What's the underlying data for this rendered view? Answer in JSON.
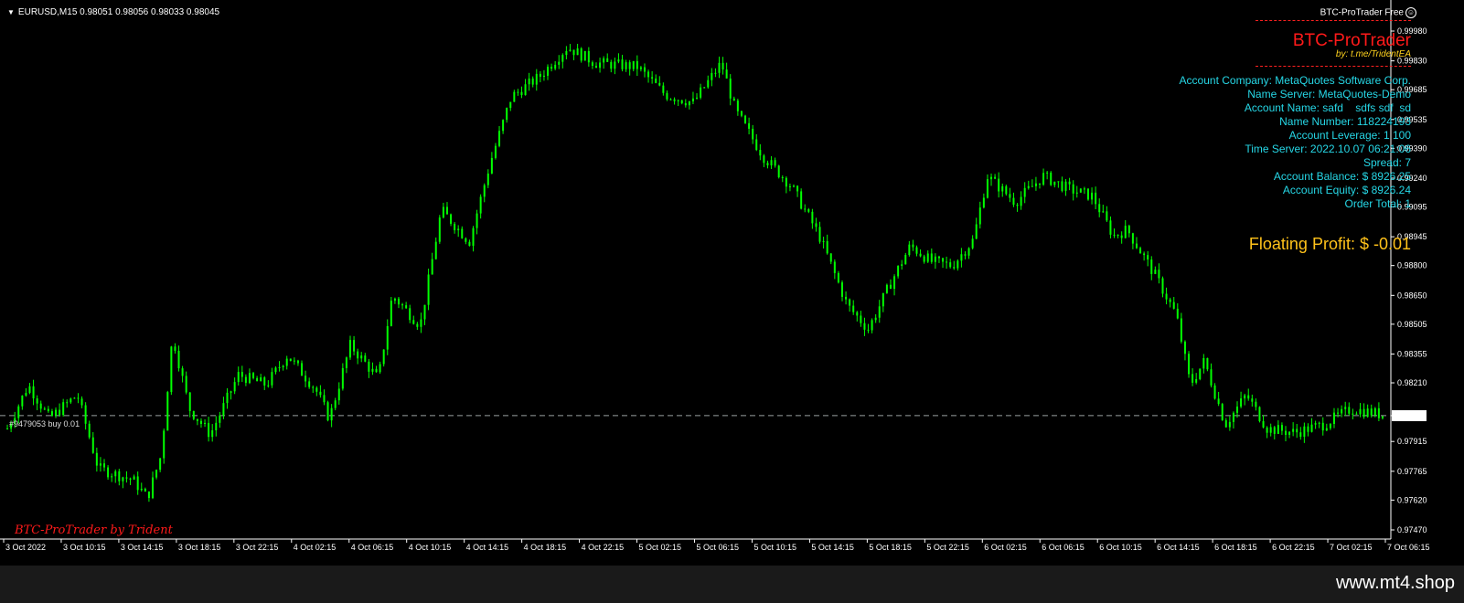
{
  "window": {
    "symbol_line": "EURUSD,M15  0.98051 0.98056 0.98033 0.98045",
    "ea_status": "BTC-ProTrader Free"
  },
  "brand": {
    "title": "BTC-ProTrader",
    "subtitle": "by: t.me/TridentEA",
    "accent_color": "#ff1a1a",
    "sub_color": "#ffd21e"
  },
  "account_info": [
    "Account Company: MetaQuotes Software Corp.",
    "Name Server: MetaQuotes-Demo",
    "Account Name: safd    sdfs sdf  sd",
    "Name Number: 118224193",
    "Account Leverage: 1 100",
    "Time Server: 2022.10.07 06:21:06",
    "Spread: 7",
    "Account Balance: $ 8926.25",
    "Account Equity: $ 8926.24",
    "Order Total: 1"
  ],
  "floating_profit": "Floating Profit: $ -0.01",
  "watermark": "BTC-ProTrader by Trident",
  "order_label": "#9479053 buy 0.01",
  "footer": "www.mt4.shop",
  "colors": {
    "candle": "#00ff00",
    "info_text": "#26d7e6",
    "floating_profit": "#ffc21a",
    "background": "#000000"
  },
  "chart_data": {
    "type": "candlestick",
    "symbol": "EURUSD",
    "timeframe": "M15",
    "current_price": "0.98045",
    "price_ticks": [
      "0.99980",
      "0.99830",
      "0.99685",
      "0.99535",
      "0.99390",
      "0.99240",
      "0.99095",
      "0.98945",
      "0.98800",
      "0.98650",
      "0.98505",
      "0.98355",
      "0.98210",
      "0.98045",
      "0.97915",
      "0.97765",
      "0.97620",
      "0.97470"
    ],
    "time_ticks": [
      "3 Oct 2022",
      "3 Oct 10:15",
      "3 Oct 14:15",
      "3 Oct 18:15",
      "3 Oct 22:15",
      "4 Oct 02:15",
      "4 Oct 06:15",
      "4 Oct 10:15",
      "4 Oct 14:15",
      "4 Oct 18:15",
      "4 Oct 22:15",
      "5 Oct 02:15",
      "5 Oct 06:15",
      "5 Oct 10:15",
      "5 Oct 14:15",
      "5 Oct 18:15",
      "5 Oct 22:15",
      "6 Oct 02:15",
      "6 Oct 06:15",
      "6 Oct 10:15",
      "6 Oct 14:15",
      "6 Oct 18:15",
      "6 Oct 22:15",
      "7 Oct 02:15",
      "7 Oct 06:15"
    ],
    "ylim": [
      0.9747,
      0.9998
    ],
    "order_line_price": 0.98045,
    "price_path_keypoints": [
      [
        0,
        0.9798
      ],
      [
        0.015,
        0.982
      ],
      [
        0.03,
        0.9803
      ],
      [
        0.05,
        0.9815
      ],
      [
        0.065,
        0.9778
      ],
      [
        0.09,
        0.9772
      ],
      [
        0.1,
        0.9763
      ],
      [
        0.11,
        0.9785
      ],
      [
        0.118,
        0.9845
      ],
      [
        0.13,
        0.9808
      ],
      [
        0.145,
        0.9795
      ],
      [
        0.165,
        0.9825
      ],
      [
        0.185,
        0.982
      ],
      [
        0.2,
        0.9835
      ],
      [
        0.22,
        0.9818
      ],
      [
        0.23,
        0.9803
      ],
      [
        0.245,
        0.984
      ],
      [
        0.265,
        0.9823
      ],
      [
        0.275,
        0.9865
      ],
      [
        0.295,
        0.985
      ],
      [
        0.31,
        0.9908
      ],
      [
        0.33,
        0.9892
      ],
      [
        0.345,
        0.9932
      ],
      [
        0.36,
        0.9965
      ],
      [
        0.38,
        0.9975
      ],
      [
        0.4,
        0.999
      ],
      [
        0.42,
        0.9982
      ],
      [
        0.45,
        0.998
      ],
      [
        0.47,
        0.9966
      ],
      [
        0.49,
        0.9962
      ],
      [
        0.51,
        0.9982
      ],
      [
        0.52,
        0.9958
      ],
      [
        0.54,
        0.9935
      ],
      [
        0.56,
        0.992
      ],
      [
        0.58,
        0.9895
      ],
      [
        0.6,
        0.986
      ],
      [
        0.615,
        0.9848
      ],
      [
        0.63,
        0.987
      ],
      [
        0.645,
        0.989
      ],
      [
        0.66,
        0.9882
      ],
      [
        0.675,
        0.988
      ],
      [
        0.69,
        0.9893
      ],
      [
        0.7,
        0.9925
      ],
      [
        0.72,
        0.9912
      ],
      [
        0.74,
        0.9925
      ],
      [
        0.76,
        0.9918
      ],
      [
        0.775,
        0.9915
      ],
      [
        0.79,
        0.9895
      ],
      [
        0.8,
        0.9898
      ],
      [
        0.82,
        0.9875
      ],
      [
        0.835,
        0.9855
      ],
      [
        0.845,
        0.982
      ],
      [
        0.855,
        0.9832
      ],
      [
        0.87,
        0.98
      ],
      [
        0.885,
        0.9815
      ],
      [
        0.9,
        0.9798
      ],
      [
        0.92,
        0.9796
      ],
      [
        0.94,
        0.98
      ],
      [
        0.96,
        0.9808
      ],
      [
        0.975,
        0.9806
      ],
      [
        0.985,
        0.98045
      ]
    ]
  }
}
